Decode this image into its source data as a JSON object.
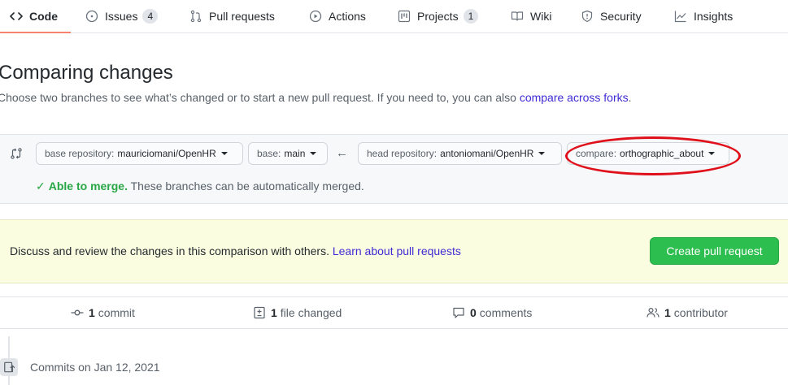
{
  "tabs": [
    {
      "label": "Code"
    },
    {
      "label": "Issues",
      "count": "4"
    },
    {
      "label": "Pull requests"
    },
    {
      "label": "Actions"
    },
    {
      "label": "Projects",
      "count": "1"
    },
    {
      "label": "Wiki"
    },
    {
      "label": "Security"
    },
    {
      "label": "Insights"
    }
  ],
  "header": {
    "title": "Comparing changes",
    "description": "Choose two branches to see what’s changed or to start a new pull request. If you need to, you can also",
    "compare_forks_link": "compare across forks",
    "period": "."
  },
  "range": {
    "base_repo_label": "base repository:",
    "base_repo_value": "mauriciomani/OpenHR",
    "base_label": "base:",
    "base_value": "main",
    "head_repo_label": "head repository:",
    "head_repo_value": "antoniomani/OpenHR",
    "compare_label": "compare:",
    "compare_value": "orthographic_about",
    "merge_ok": "Able to merge.",
    "merge_detail": "These branches can be automatically merged."
  },
  "blurb": {
    "text": "Discuss and review the changes in this comparison with others.",
    "link": "Learn about pull requests",
    "button": "Create pull request"
  },
  "summary": {
    "commits_count": "1",
    "commits_label": "commit",
    "files_count": "1",
    "files_label": "file changed",
    "comments_count": "0",
    "comments_label": "comments",
    "contributors_count": "1",
    "contributors_label": "contributor"
  },
  "commits": {
    "date_heading": "Commits on Jan 12, 2021"
  },
  "colors": {
    "accent_tab": "#f9826c",
    "primary_button": "#2cbe4e",
    "link": "#3f2bd4",
    "highlight_ring": "#e0101a"
  }
}
